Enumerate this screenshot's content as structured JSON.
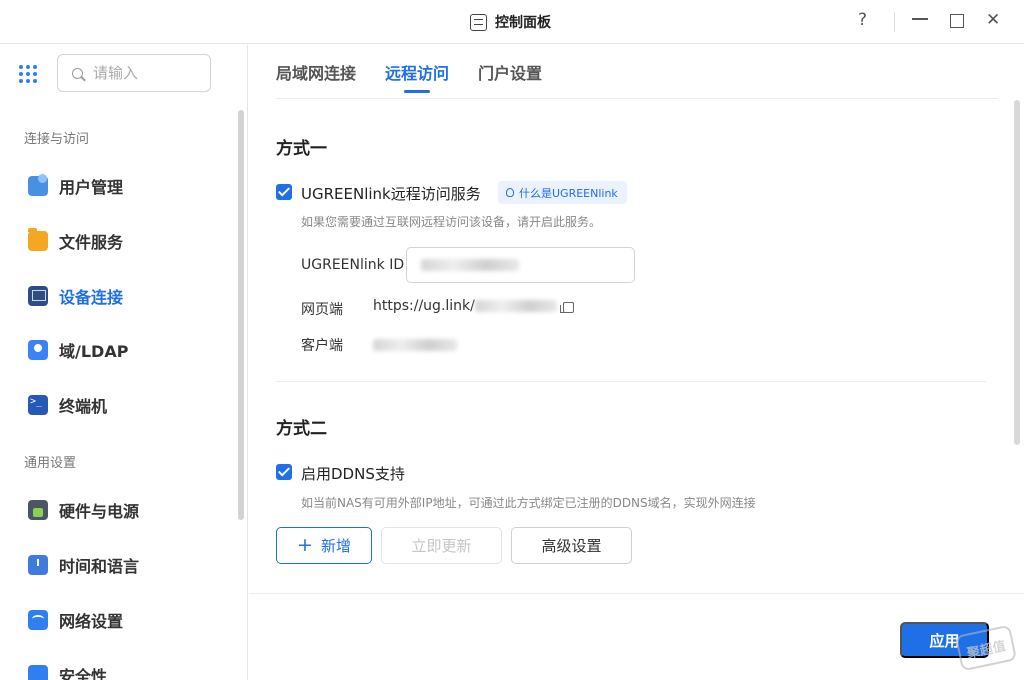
{
  "window": {
    "title": "控制面板",
    "help": "?",
    "close": "✕"
  },
  "sidebar": {
    "search_placeholder": "请输入",
    "groups": [
      {
        "label": "连接与访问"
      },
      {
        "label": "通用设置"
      }
    ],
    "items": [
      {
        "label": "用户管理",
        "icon": "users-icon"
      },
      {
        "label": "文件服务",
        "icon": "folder-icon"
      },
      {
        "label": "设备连接",
        "icon": "device-icon",
        "active": true
      },
      {
        "label": "域/LDAP",
        "icon": "ldap-icon"
      },
      {
        "label": "终端机",
        "icon": "terminal-icon"
      },
      {
        "label": "硬件与电源",
        "icon": "power-icon"
      },
      {
        "label": "时间和语言",
        "icon": "clock-icon"
      },
      {
        "label": "网络设置",
        "icon": "network-icon"
      },
      {
        "label": "安全性",
        "icon": "shield-icon"
      }
    ]
  },
  "tabs": [
    {
      "label": "局域网连接"
    },
    {
      "label": "远程访问",
      "active": true
    },
    {
      "label": "门户设置"
    }
  ],
  "method1": {
    "title": "方式一",
    "checkbox_label": "UGREENlink远程访问服务",
    "checked": true,
    "hint": "什么是UGREENlink",
    "desc": "如果您需要通过互联网远程访问该设备，请开启此服务。",
    "id_label": "UGREENlink ID",
    "web_label": "网页端",
    "web_value": "https://ug.link/",
    "client_label": "客户端"
  },
  "method2": {
    "title": "方式二",
    "checkbox_label": "启用DDNS支持",
    "checked": true,
    "desc": "如当前NAS有可用外部IP地址，可通过此方式绑定已注册的DDNS域名，实现外网连接",
    "add_label": "新增",
    "add_icon": "+",
    "refresh_label": "立即更新",
    "advanced_label": "高级设置"
  },
  "footer": {
    "apply_label": "应用"
  },
  "watermark": "聚超值",
  "colors": {
    "accent": "#1f6fe6",
    "hint_bg": "#eaf2ff"
  }
}
